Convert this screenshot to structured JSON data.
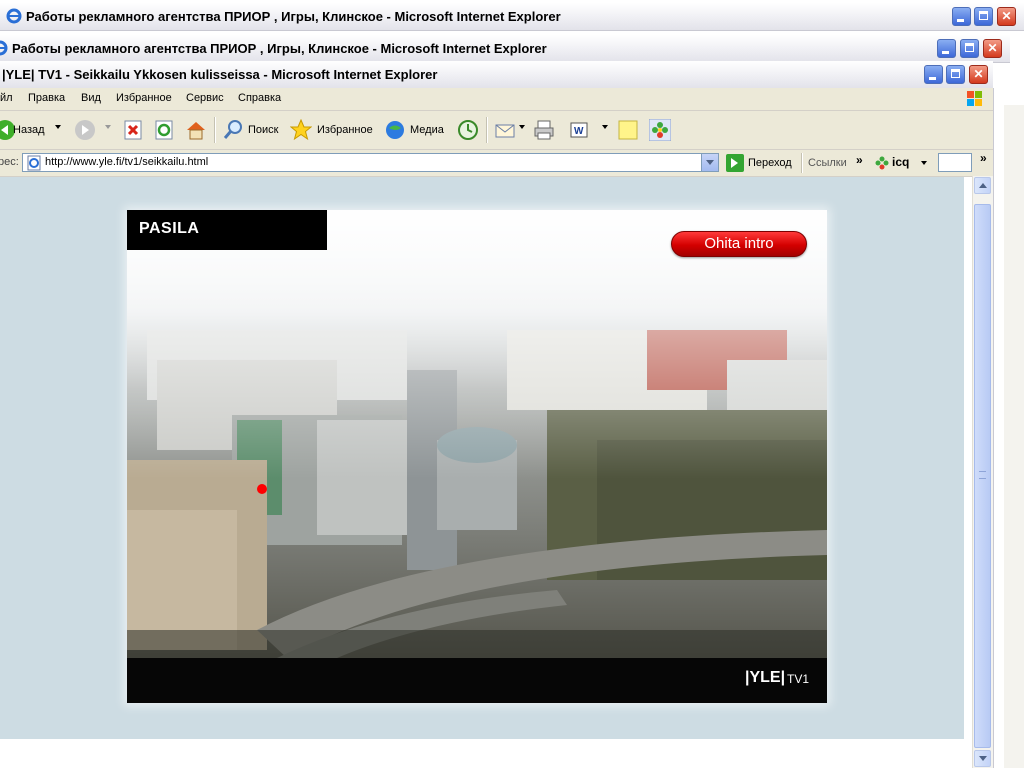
{
  "windows": [
    {
      "title": "Работы рекламного агентства ПРИОР , Игры, Клинское - Microsoft Internet Explorer"
    },
    {
      "title": "Работы рекламного агентства ПРИОР , Игры, Клинское - Microsoft Internet Explorer"
    },
    {
      "title": "|YLE| TV1 - Seikkailu Ykkosen kulisseissa - Microsoft Internet Explorer"
    }
  ],
  "menu": [
    "йл",
    "Правка",
    "Вид",
    "Избранное",
    "Сервис",
    "Справка"
  ],
  "toolbar": {
    "back": "Назад",
    "search": "Поиск",
    "favorites": "Избранное",
    "media": "Медиа"
  },
  "address": {
    "label": "рес:",
    "url": "http://www.yle.fi/tv1/seikkailu.html",
    "go": "Переход",
    "links": "Ссылки",
    "icq": "icq"
  },
  "flash": {
    "location": "PASILA",
    "skip_button": "Ohita intro",
    "brand": "|YLE|",
    "channel": "TV1"
  },
  "colors": {
    "page_bg": "#cddce3",
    "skip_red": "#d40000",
    "footer_black": "#060606"
  }
}
